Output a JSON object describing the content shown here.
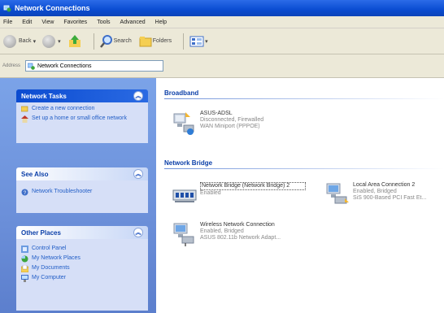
{
  "window": {
    "title": "Network Connections"
  },
  "menu": [
    "File",
    "Edit",
    "View",
    "Favorites",
    "Tools",
    "Advanced",
    "Help"
  ],
  "toolbar": {
    "back": "Back",
    "search": "Search",
    "folders": "Folders"
  },
  "address": {
    "label": "Address",
    "value": "Network Connections"
  },
  "network_tasks": {
    "title": "Network Tasks",
    "items": [
      "Create a new connection",
      "Set up a home or small office network"
    ]
  },
  "see_also": {
    "title": "See Also",
    "items": [
      "Network Troubleshooter"
    ]
  },
  "other_places": {
    "title": "Other Places",
    "items": [
      "Control Panel",
      "My Network Places",
      "My Documents",
      "My Computer"
    ]
  },
  "groups": {
    "broadband": {
      "title": "Broadband",
      "items": [
        {
          "name": "ASUS-ADSL",
          "line1": "Disconnected, Firewalled",
          "line2": "WAN Miniport (PPPOE)"
        }
      ]
    },
    "bridge": {
      "title": "Network Bridge",
      "items": [
        {
          "name": "Network Bridge (Network Bridge) 2",
          "line1": "Enabled",
          "line2": ""
        },
        {
          "name": "Local Area Connection 2",
          "line1": "Enabled, Bridged",
          "line2": "SiS 900-Based PCI Fast Et..."
        },
        {
          "name": "Wireless Network Connection",
          "line1": "Enabled, Bridged",
          "line2": "ASUS 802.11b Network Adapt..."
        }
      ]
    }
  }
}
